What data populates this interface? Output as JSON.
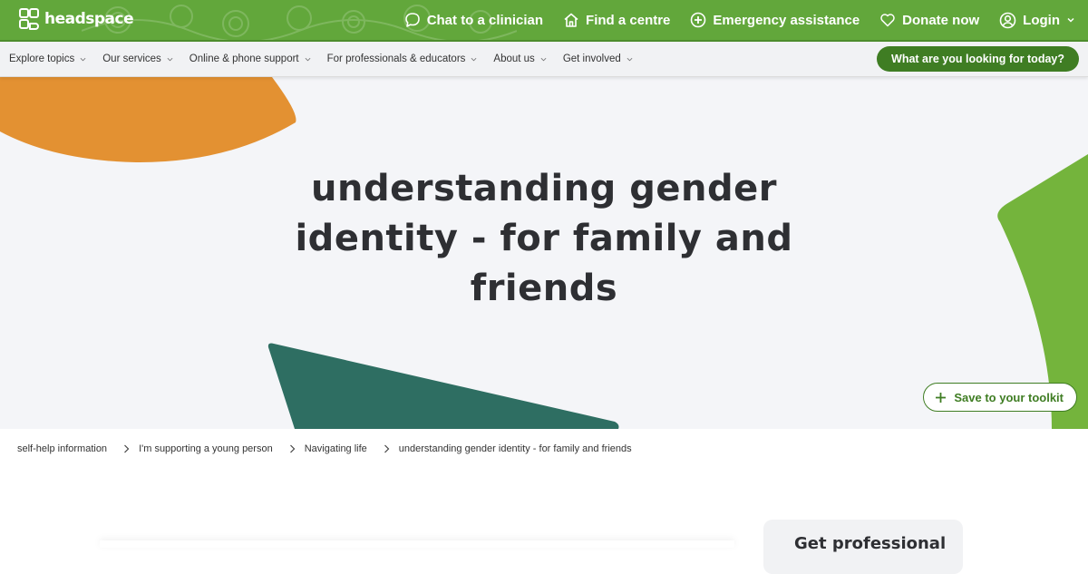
{
  "brand": {
    "name": "headspace"
  },
  "top_links": [
    {
      "label": "Chat to a clinician",
      "icon": "chat-bubble-icon"
    },
    {
      "label": "Find a centre",
      "icon": "home-icon"
    },
    {
      "label": "Emergency assistance",
      "icon": "plus-circle-icon"
    },
    {
      "label": "Donate now",
      "icon": "heart-icon"
    },
    {
      "label": "Login",
      "icon": "user-circle-icon"
    }
  ],
  "nav": {
    "items": [
      {
        "label": "Explore topics"
      },
      {
        "label": "Our services"
      },
      {
        "label": "Online & phone support"
      },
      {
        "label": "For professionals & educators"
      },
      {
        "label": "About us"
      },
      {
        "label": "Get involved"
      }
    ],
    "cta_label": "What are you looking for today?"
  },
  "hero": {
    "title": "understanding gender identity - for family and friends",
    "save_label": "Save to your toolkit"
  },
  "breadcrumb": [
    "self-help information",
    "I'm supporting a young person",
    "Navigating life",
    "understanding gender identity - for family and friends"
  ],
  "side_card": {
    "title": "Get professional"
  },
  "colors": {
    "brand_green": "#62a73b",
    "dark_green": "#3f7d23",
    "orange": "#e39132",
    "teal": "#2e6e62",
    "lime": "#74b43c",
    "hero_bg": "#f4f5f8"
  }
}
